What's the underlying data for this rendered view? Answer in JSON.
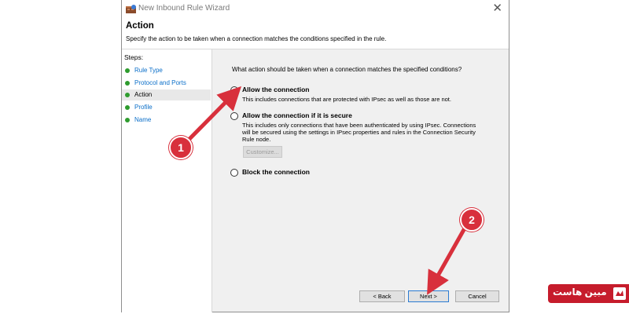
{
  "window": {
    "title": "New Inbound Rule Wizard",
    "close_glyph": "✕",
    "header_title": "Action",
    "header_subtitle": "Specify the action to be taken when a connection matches the conditions specified in the rule."
  },
  "steps": {
    "title": "Steps:",
    "items": [
      {
        "label": "Rule Type",
        "state": "link"
      },
      {
        "label": "Protocol and Ports",
        "state": "link"
      },
      {
        "label": "Action",
        "state": "current"
      },
      {
        "label": "Profile",
        "state": "link"
      },
      {
        "label": "Name",
        "state": "link"
      }
    ]
  },
  "content": {
    "question": "What action should be taken when a connection matches the specified conditions?",
    "options": [
      {
        "label": "Allow the connection",
        "desc1": "This includes connections that are protected with IPsec as well as those are not.",
        "checked": true
      },
      {
        "label": "Allow the connection if it is secure",
        "desc1": "This includes only connections that have been authenticated by using IPsec.  Connections",
        "desc2": "will be secured using the settings in IPsec properties and rules in the Connection Security",
        "desc3": "Rule node.",
        "checked": false
      },
      {
        "label": "Block the connection",
        "checked": false
      }
    ],
    "customize_label": "Customize..."
  },
  "buttons": {
    "back": "< Back",
    "next": "Next >",
    "cancel": "Cancel"
  },
  "annotations": {
    "badge1": "1",
    "badge2": "2",
    "color": "#d8303c"
  },
  "watermark": {
    "text": "مبین هاست",
    "color": "#c61c2c"
  }
}
